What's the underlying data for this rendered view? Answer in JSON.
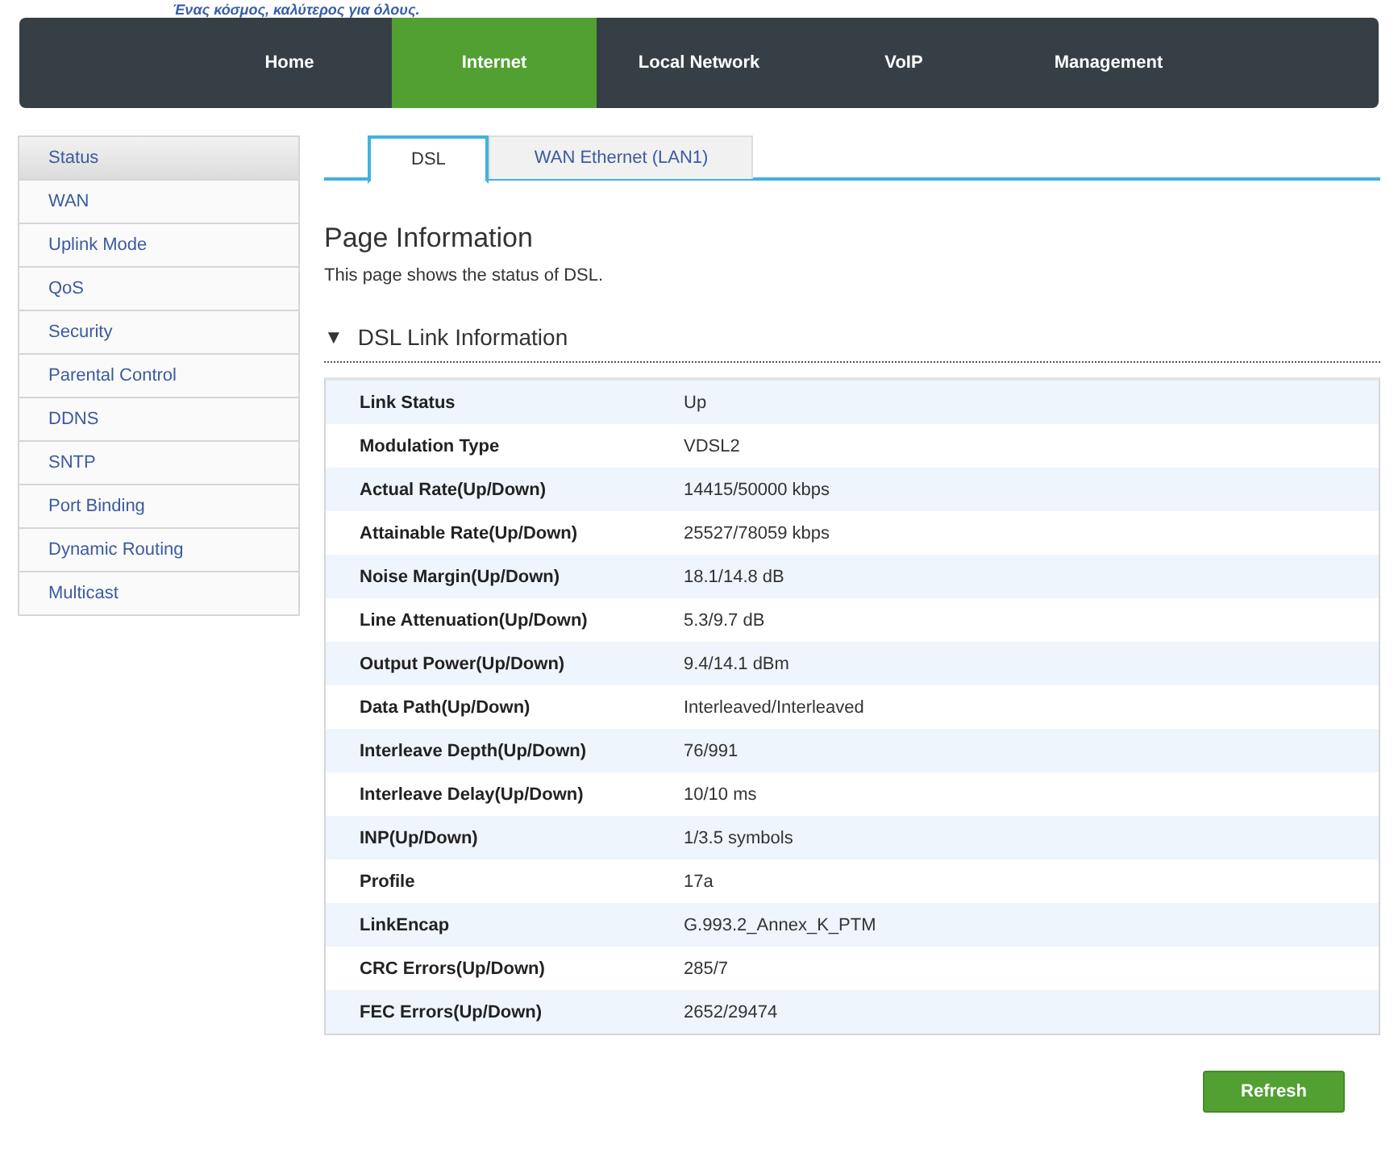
{
  "slogan": "Ένας κόσμος, καλύτερος για όλους.",
  "nav": [
    {
      "label": "Home",
      "selected": false
    },
    {
      "label": "Internet",
      "selected": true
    },
    {
      "label": "Local Network",
      "selected": false
    },
    {
      "label": "VoIP",
      "selected": false
    },
    {
      "label": "Management",
      "selected": false
    }
  ],
  "sidebar": {
    "items": [
      {
        "label": "Status",
        "selected": true
      },
      {
        "label": "WAN",
        "selected": false
      },
      {
        "label": "Uplink Mode",
        "selected": false
      },
      {
        "label": "QoS",
        "selected": false
      },
      {
        "label": "Security",
        "selected": false
      },
      {
        "label": "Parental Control",
        "selected": false
      },
      {
        "label": "DDNS",
        "selected": false
      },
      {
        "label": "SNTP",
        "selected": false
      },
      {
        "label": "Port Binding",
        "selected": false
      },
      {
        "label": "Dynamic Routing",
        "selected": false
      },
      {
        "label": "Multicast",
        "selected": false
      }
    ]
  },
  "tabs": [
    {
      "label": "DSL",
      "selected": true
    },
    {
      "label": "WAN Ethernet (LAN1)",
      "selected": false
    }
  ],
  "page_title": "Page Information",
  "description": "This page shows the status of DSL.",
  "section": {
    "title": "DSL Link Information",
    "expanded": true,
    "toggle": "▼"
  },
  "table": {
    "rows": [
      {
        "label": "Link Status",
        "value": "Up"
      },
      {
        "label": "Modulation Type",
        "value": "VDSL2"
      },
      {
        "label": "Actual Rate(Up/Down)",
        "value": "14415/50000 kbps"
      },
      {
        "label": "Attainable Rate(Up/Down)",
        "value": "25527/78059 kbps"
      },
      {
        "label": "Noise Margin(Up/Down)",
        "value": "18.1/14.8 dB"
      },
      {
        "label": "Line Attenuation(Up/Down)",
        "value": "5.3/9.7 dB"
      },
      {
        "label": "Output Power(Up/Down)",
        "value": "9.4/14.1 dBm"
      },
      {
        "label": "Data Path(Up/Down)",
        "value": "Interleaved/Interleaved"
      },
      {
        "label": "Interleave Depth(Up/Down)",
        "value": "76/991"
      },
      {
        "label": "Interleave Delay(Up/Down)",
        "value": "10/10 ms"
      },
      {
        "label": "INP(Up/Down)",
        "value": "1/3.5 symbols"
      },
      {
        "label": "Profile",
        "value": "17a"
      },
      {
        "label": "LinkEncap",
        "value": "G.993.2_Annex_K_PTM"
      },
      {
        "label": "CRC Errors(Up/Down)",
        "value": "285/7"
      },
      {
        "label": "FEC Errors(Up/Down)",
        "value": "2652/29474"
      }
    ]
  },
  "buttons": [
    {
      "label": "Refresh"
    }
  ]
}
